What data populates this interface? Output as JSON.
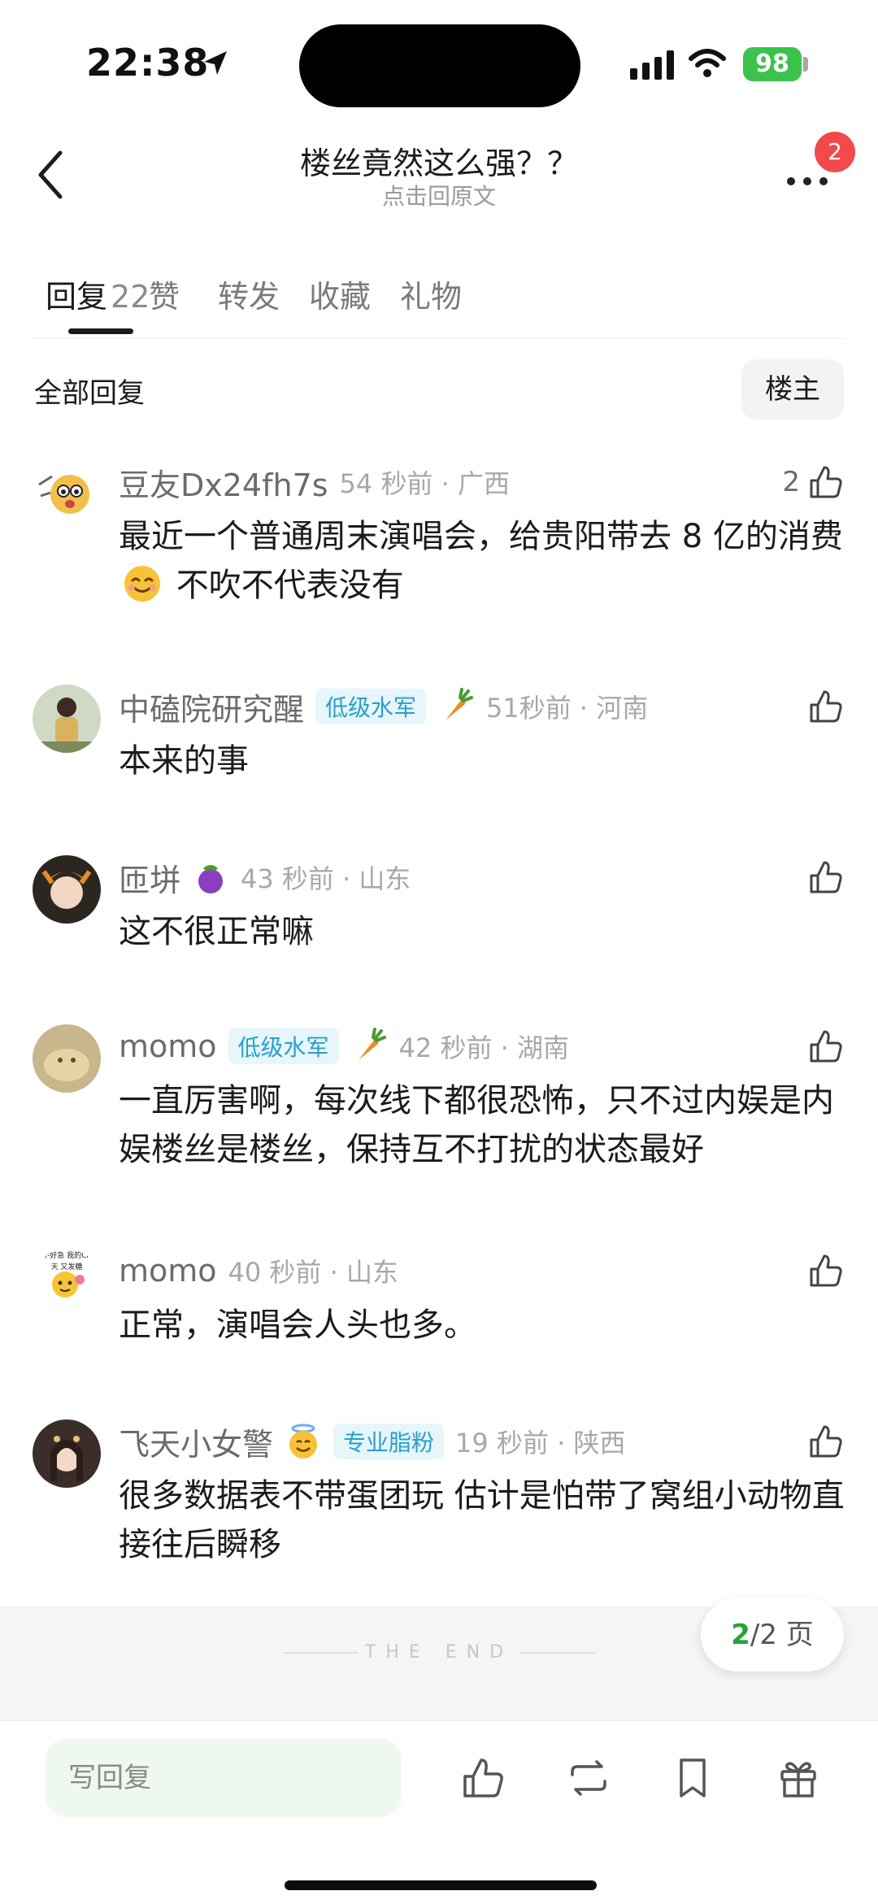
{
  "status_bar": {
    "time": "22:38",
    "battery": "98"
  },
  "header": {
    "title": "楼丝竟然这么强？？",
    "subtitle": "点击回原文",
    "notification_badge": "2"
  },
  "tabs": [
    {
      "label": "回复",
      "count": "22"
    },
    {
      "label": "赞"
    },
    {
      "label": "转发"
    },
    {
      "label": "收藏"
    },
    {
      "label": "礼物"
    }
  ],
  "filter": {
    "label": "全部回复",
    "op_button": "楼主"
  },
  "comments": [
    {
      "nickname": "豆友Dx24fh7s",
      "time_loc": "54 秒前 · 广西",
      "likes": "2",
      "text_a": "最近一个普通周末演唱会，给贵阳带去 8 亿的消费",
      "text_b": "不吹不代表没有"
    },
    {
      "nickname": "中磕院研究醒",
      "level": "低级水军",
      "time_loc": "51秒前 · 河南",
      "text": "本来的事"
    },
    {
      "nickname": "匝垪",
      "time_loc": "43 秒前 · 山东",
      "text": "这不很正常嘛"
    },
    {
      "nickname": "momo",
      "level": "低级水军",
      "time_loc": "42 秒前 · 湖南",
      "text": "一直厉害啊，每次线下都很恐怖，只不过内娱是内娱楼丝是楼丝，保持互不打扰的状态最好"
    },
    {
      "nickname": "momo",
      "time_loc": "40 秒前 · 山东",
      "text": "正常，演唱会人头也多。",
      "avatar_caption": "真不好急 我的CP今天 又发糖"
    },
    {
      "nickname": "飞天小女警",
      "level": "专业脂粉",
      "time_loc": "19 秒前 · 陕西",
      "text": "很多数据表不带蛋团玩 估计是怕带了窝组小动物直接往后瞬移"
    }
  ],
  "end": {
    "text": "THE END"
  },
  "pager": {
    "current": "2",
    "total": "/2 页"
  },
  "bottom": {
    "reply_placeholder": "写回复"
  },
  "colors": {
    "accent_green": "#2aa03a",
    "badge_red": "#f24a4a",
    "level_blue": "#2a9fc9"
  },
  "icons": [
    "location-arrow-icon",
    "signal-icon",
    "wifi-icon",
    "back-icon",
    "more-icon",
    "like-icon",
    "carrot-icon",
    "eggplant-icon",
    "angel-emoji-icon",
    "smile-emoji-icon",
    "repost-icon",
    "bookmark-icon",
    "gift-icon"
  ]
}
